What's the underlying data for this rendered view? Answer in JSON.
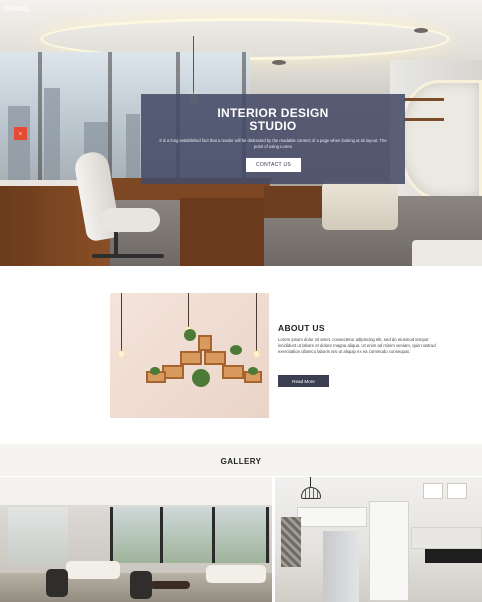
{
  "brand": {
    "logo": "SHAPEL"
  },
  "hero": {
    "title": "INTERIOR DESIGN\nSTUDIO",
    "description": "It is a long established fact that a reader will be distracted by the readable content of a page when looking at its layout. The point of using Lorem",
    "cta_label": "CONTACT US",
    "menu_icon_glyph": "≡"
  },
  "about": {
    "title": "ABOUT US",
    "text": "Lorem ipsum dolor sit amet, consectetur adipiscing elit, sed do eiusmod tempor incididunt ut labore et dolore magna aliqua. Ut enim ad minim veniam, quis nostrud exercitation ullamco laboris nisi ut aliquip ex ea commodo consequat.",
    "button_label": "Read More"
  },
  "gallery": {
    "title": "GALLERY"
  },
  "colors": {
    "overlay": "#464b68",
    "accent_red": "#e64b35",
    "dark_button": "#3c3f52",
    "gallery_band": "#f6f4f1"
  }
}
